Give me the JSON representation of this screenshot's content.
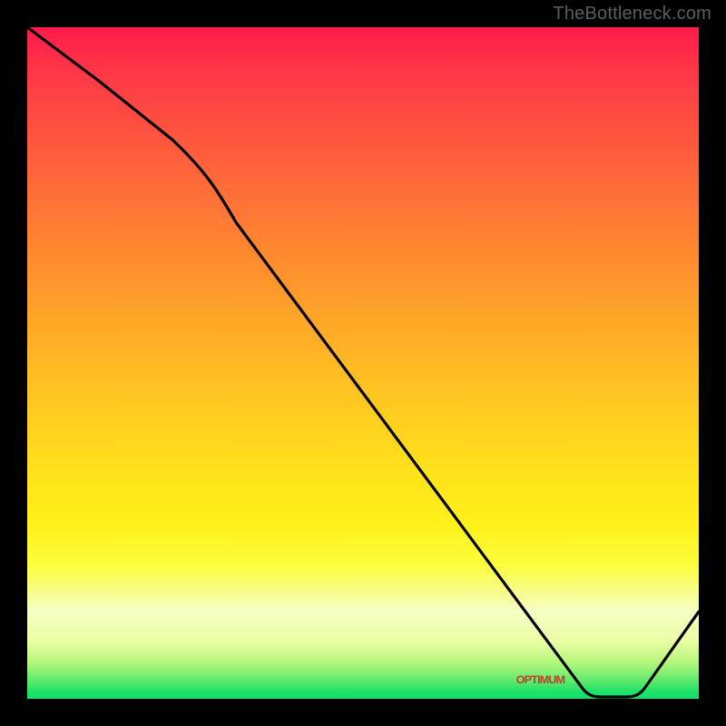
{
  "watermark": "TheBottleneck.com",
  "optimum_label": "OPTIMUM",
  "optimum_pos": {
    "left_pct": 73,
    "top_pct": 96.2
  },
  "chart_data": {
    "type": "line",
    "title": "",
    "xlabel": "",
    "ylabel": "",
    "xlim": [
      0,
      100
    ],
    "ylim": [
      0,
      100
    ],
    "grid": false,
    "legend": false,
    "background": "rainbow-gradient-red-to-green",
    "series": [
      {
        "name": "bottleneck-curve",
        "color": "#000000",
        "x": [
          0,
          10,
          20,
          27,
          35,
          45,
          55,
          65,
          75,
          83,
          88,
          93,
          100
        ],
        "y": [
          100,
          92,
          83,
          76,
          62,
          48,
          34,
          20,
          6,
          0,
          0,
          5,
          13
        ],
        "notes": "y is qualitative bottleneck level (0=none/green, 100=max/red). Values estimated from rendered curve against vertical gradient; minimum (optimum) lies roughly at x≈83-88."
      }
    ],
    "annotations": [
      {
        "text": "OPTIMUM",
        "x": 84,
        "y": 1,
        "color": "#c33b2c"
      }
    ]
  }
}
